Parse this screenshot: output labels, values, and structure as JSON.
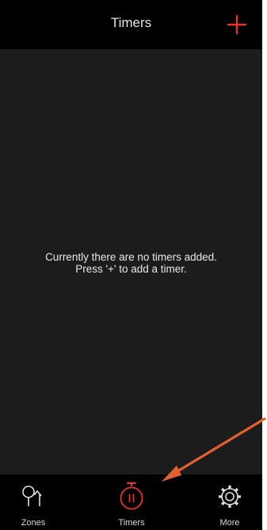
{
  "header": {
    "title": "Timers",
    "add_icon": "plus-icon"
  },
  "main": {
    "empty_line1": "Currently there are no timers added.",
    "empty_line2": "Press '+' to add a timer."
  },
  "tabbar": {
    "tabs": [
      {
        "label": "Zones",
        "icon": "zones-icon",
        "active": false
      },
      {
        "label": "Timers",
        "icon": "stopwatch-icon",
        "active": true
      },
      {
        "label": "More",
        "icon": "gear-icon",
        "active": false
      }
    ]
  },
  "colors": {
    "accent": "#e8322a",
    "annotation_arrow": "#e4602f",
    "background": "#1c1c1c",
    "bars": "#000000",
    "text": "#e8e8e8"
  }
}
